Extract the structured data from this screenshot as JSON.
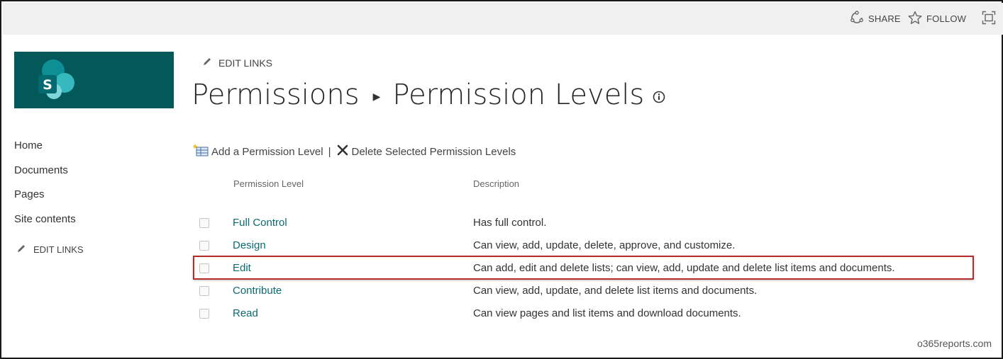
{
  "topbar": {
    "share_label": "SHARE",
    "follow_label": "FOLLOW"
  },
  "icons": {
    "share": "share-icon",
    "follow": "star-icon",
    "focus": "focus-mode-icon",
    "edit": "pencil-icon",
    "info": "info-icon",
    "add": "add-permission-level-icon",
    "delete": "delete-x-icon",
    "logo": "sharepoint-logo-icon"
  },
  "colors": {
    "brand_tile": "#03585a",
    "link": "#0b6a74",
    "highlight_box": "#b52a2a",
    "topbar_bg": "#f0f0f0"
  },
  "nav": {
    "items": [
      {
        "label": "Home"
      },
      {
        "label": "Documents"
      },
      {
        "label": "Pages"
      },
      {
        "label": "Site contents"
      }
    ],
    "edit_links_label": "EDIT LINKS"
  },
  "header": {
    "edit_links_label": "EDIT LINKS",
    "breadcrumb_parent": "Permissions",
    "breadcrumb_current": "Permission Levels"
  },
  "toolbar": {
    "add_label": "Add a Permission Level",
    "separator": "|",
    "delete_label": "Delete Selected Permission Levels"
  },
  "table": {
    "columns": [
      "Permission Level",
      "Description"
    ],
    "rows": [
      {
        "level": "Full Control",
        "description": "Has full control.",
        "checked": false
      },
      {
        "level": "Design",
        "description": "Can view, add, update, delete, approve, and customize.",
        "checked": false
      },
      {
        "level": "Edit",
        "description": "Can add, edit and delete lists; can view, add, update and delete list items and documents.",
        "checked": false,
        "highlighted": true
      },
      {
        "level": "Contribute",
        "description": "Can view, add, update, and delete list items and documents.",
        "checked": false
      },
      {
        "level": "Read",
        "description": "Can view pages and list items and download documents.",
        "checked": false
      }
    ]
  },
  "watermark": "o365reports.com"
}
